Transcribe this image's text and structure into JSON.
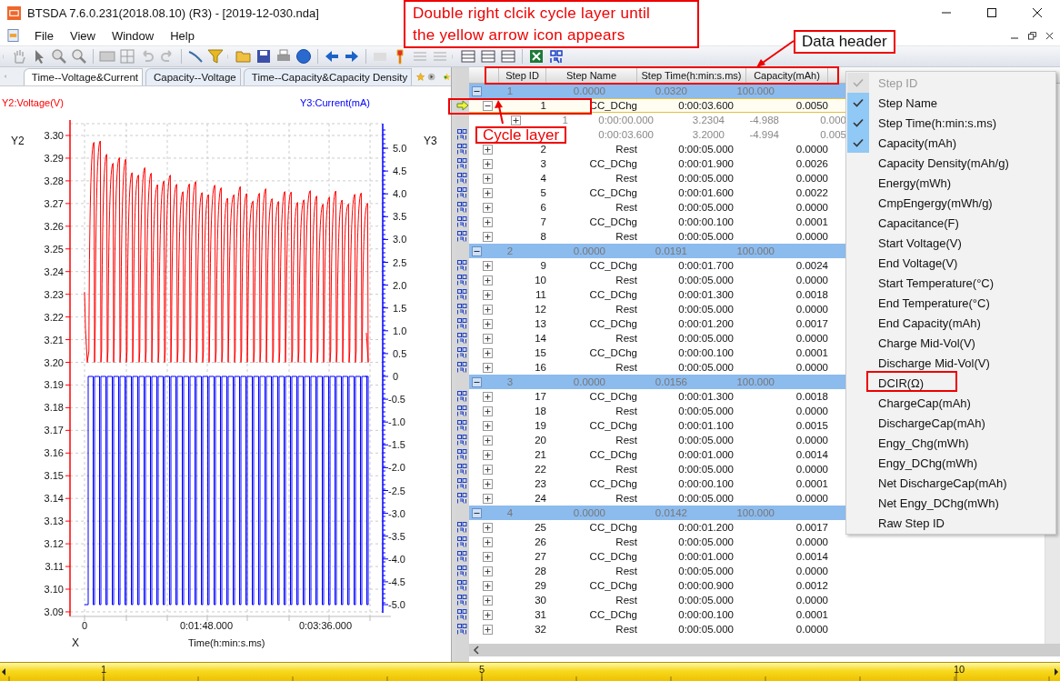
{
  "window": {
    "title": "BTSDA 7.6.0.231(2018.08.10) (R3) - [2019-12-030.nda]"
  },
  "menu": [
    "File",
    "View",
    "Window",
    "Help"
  ],
  "chart_tabs": [
    {
      "label": "Time--Voltage&Current",
      "selected": true
    },
    {
      "label": "Capacity--Voltage",
      "selected": false
    },
    {
      "label": "Time--Capacity&Capacity Density",
      "selected": false
    }
  ],
  "chart": {
    "y2_title": "Y2:Voltage(V)",
    "y3_title": "Y3:Current(mA)",
    "y2_name": "Y2",
    "y3_name": "Y3",
    "x_name": "X",
    "x_title": "Time(h:min:s.ms)",
    "y2_ticks": [
      "3.30",
      "3.29",
      "3.28",
      "3.27",
      "3.26",
      "3.25",
      "3.24",
      "3.23",
      "3.22",
      "3.21",
      "3.20",
      "3.19",
      "3.18",
      "3.17",
      "3.16",
      "3.15",
      "3.14",
      "3.13",
      "3.12",
      "3.11",
      "3.10",
      "3.09"
    ],
    "y3_ticks": [
      "5.0",
      "4.5",
      "4.0",
      "3.5",
      "3.0",
      "2.5",
      "2.0",
      "1.5",
      "1.0",
      "0.5",
      "0",
      "-0.5",
      "-1.0",
      "-1.5",
      "-2.0",
      "-2.5",
      "-3.0",
      "-3.5",
      "-4.0",
      "-4.5",
      "-5.0"
    ],
    "x_ticks": [
      "0",
      "0:01:48.000",
      "0:03:36.000"
    ]
  },
  "table": {
    "columns": [
      "Step ID",
      "Step Name",
      "Step Time(h:min:s.ms)",
      "Capacity(mAh)"
    ],
    "cycles": [
      {
        "cells": [
          "1",
          "0.0000",
          "0.0320",
          "100.000"
        ],
        "expanded": true,
        "steps": [
          {
            "cells": [
              "1",
              "CC_DChg",
              "0:00:03.600",
              "0.0050"
            ],
            "kind": "arrow",
            "expanded": true,
            "selected": true,
            "records": [
              {
                "id": "1",
                "cells": [
                  "0:00:00.000",
                  "3.2304",
                  "-4.988",
                  "0.000"
                ],
                "expanded": false
              },
              {
                "cells": [
                  "0:00:03.600",
                  "3.2000",
                  "-4.994",
                  "0.005"
                ],
                "kind": "dcir"
              }
            ]
          },
          {
            "cells": [
              "2",
              "Rest",
              "0:00:05.000",
              "0.0000"
            ],
            "kind": "dcir",
            "expanded": false,
            "selected": false
          },
          {
            "cells": [
              "3",
              "CC_DChg",
              "0:00:01.900",
              "0.0026"
            ],
            "kind": "dcir",
            "expanded": false,
            "selected": false
          },
          {
            "cells": [
              "4",
              "Rest",
              "0:00:05.000",
              "0.0000"
            ],
            "kind": "dcir",
            "expanded": false,
            "selected": false
          },
          {
            "cells": [
              "5",
              "CC_DChg",
              "0:00:01.600",
              "0.0022"
            ],
            "kind": "dcir",
            "expanded": false,
            "selected": false
          },
          {
            "cells": [
              "6",
              "Rest",
              "0:00:05.000",
              "0.0000"
            ],
            "kind": "dcir",
            "expanded": false,
            "selected": false
          },
          {
            "cells": [
              "7",
              "CC_DChg",
              "0:00:00.100",
              "0.0001"
            ],
            "kind": "dcir",
            "expanded": false,
            "selected": false
          },
          {
            "cells": [
              "8",
              "Rest",
              "0:00:05.000",
              "0.0000"
            ],
            "kind": "dcir",
            "expanded": false,
            "selected": false
          }
        ]
      },
      {
        "cells": [
          "2",
          "0.0000",
          "0.0191",
          "100.000"
        ],
        "expanded": true,
        "steps": [
          {
            "cells": [
              "9",
              "CC_DChg",
              "0:00:01.700",
              "0.0024"
            ],
            "kind": "dcir",
            "expanded": false,
            "selected": false
          },
          {
            "cells": [
              "10",
              "Rest",
              "0:00:05.000",
              "0.0000"
            ],
            "kind": "dcir",
            "expanded": false,
            "selected": false
          },
          {
            "cells": [
              "11",
              "CC_DChg",
              "0:00:01.300",
              "0.0018"
            ],
            "kind": "dcir",
            "expanded": false,
            "selected": false
          },
          {
            "cells": [
              "12",
              "Rest",
              "0:00:05.000",
              "0.0000"
            ],
            "kind": "dcir",
            "expanded": false,
            "selected": false
          },
          {
            "cells": [
              "13",
              "CC_DChg",
              "0:00:01.200",
              "0.0017"
            ],
            "kind": "dcir",
            "expanded": false,
            "selected": false
          },
          {
            "cells": [
              "14",
              "Rest",
              "0:00:05.000",
              "0.0000"
            ],
            "kind": "dcir",
            "expanded": false,
            "selected": false
          },
          {
            "cells": [
              "15",
              "CC_DChg",
              "0:00:00.100",
              "0.0001"
            ],
            "kind": "dcir",
            "expanded": false,
            "selected": false
          },
          {
            "cells": [
              "16",
              "Rest",
              "0:00:05.000",
              "0.0000"
            ],
            "kind": "dcir",
            "expanded": false,
            "selected": false
          }
        ]
      },
      {
        "cells": [
          "3",
          "0.0000",
          "0.0156",
          "100.000"
        ],
        "expanded": true,
        "steps": [
          {
            "cells": [
              "17",
              "CC_DChg",
              "0:00:01.300",
              "0.0018"
            ],
            "kind": "dcir",
            "expanded": false,
            "selected": false
          },
          {
            "cells": [
              "18",
              "Rest",
              "0:00:05.000",
              "0.0000"
            ],
            "kind": "dcir",
            "expanded": false,
            "selected": false
          },
          {
            "cells": [
              "19",
              "CC_DChg",
              "0:00:01.100",
              "0.0015"
            ],
            "kind": "dcir",
            "expanded": false,
            "selected": false
          },
          {
            "cells": [
              "20",
              "Rest",
              "0:00:05.000",
              "0.0000"
            ],
            "kind": "dcir",
            "expanded": false,
            "selected": false
          },
          {
            "cells": [
              "21",
              "CC_DChg",
              "0:00:01.000",
              "0.0014"
            ],
            "kind": "dcir",
            "expanded": false,
            "selected": false
          },
          {
            "cells": [
              "22",
              "Rest",
              "0:00:05.000",
              "0.0000"
            ],
            "kind": "dcir",
            "expanded": false,
            "selected": false
          },
          {
            "cells": [
              "23",
              "CC_DChg",
              "0:00:00.100",
              "0.0001"
            ],
            "kind": "dcir",
            "expanded": false,
            "selected": false
          },
          {
            "cells": [
              "24",
              "Rest",
              "0:00:05.000",
              "0.0000"
            ],
            "kind": "dcir",
            "expanded": false,
            "selected": false
          }
        ]
      },
      {
        "cells": [
          "4",
          "0.0000",
          "0.0142",
          "100.000"
        ],
        "expanded": true,
        "steps": [
          {
            "cells": [
              "25",
              "CC_DChg",
              "0:00:01.200",
              "0.0017"
            ],
            "kind": "dcir",
            "expanded": false,
            "selected": false
          },
          {
            "cells": [
              "26",
              "Rest",
              "0:00:05.000",
              "0.0000"
            ],
            "kind": "dcir",
            "expanded": false,
            "selected": false
          },
          {
            "cells": [
              "27",
              "CC_DChg",
              "0:00:01.000",
              "0.0014"
            ],
            "kind": "dcir",
            "expanded": false,
            "selected": false
          },
          {
            "cells": [
              "28",
              "Rest",
              "0:00:05.000",
              "0.0000"
            ],
            "kind": "dcir",
            "expanded": false,
            "selected": false
          },
          {
            "cells": [
              "29",
              "CC_DChg",
              "0:00:00.900",
              "0.0012"
            ],
            "kind": "dcir",
            "expanded": false,
            "selected": false
          },
          {
            "cells": [
              "30",
              "Rest",
              "0:00:05.000",
              "0.0000"
            ],
            "kind": "dcir",
            "expanded": false,
            "selected": false
          },
          {
            "cells": [
              "31",
              "CC_DChg",
              "0:00:00.100",
              "0.0001"
            ],
            "kind": "dcir",
            "expanded": false,
            "selected": false
          },
          {
            "cells": [
              "32",
              "Rest",
              "0:00:05.000",
              "0.0000"
            ],
            "kind": "dcir",
            "expanded": false,
            "selected": false
          }
        ]
      }
    ]
  },
  "column_menu": {
    "items": [
      {
        "label": "Step ID",
        "checked": true,
        "disabled": true
      },
      {
        "label": "Step Name",
        "checked": true,
        "disabled": false
      },
      {
        "label": "Step Time(h:min:s.ms)",
        "checked": true,
        "disabled": false
      },
      {
        "label": "Capacity(mAh)",
        "checked": true,
        "disabled": false
      },
      {
        "label": "Capacity Density(mAh/g)",
        "checked": false,
        "disabled": false
      },
      {
        "label": "Energy(mWh)",
        "checked": false,
        "disabled": false
      },
      {
        "label": "CmpEngergy(mWh/g)",
        "checked": false,
        "disabled": false
      },
      {
        "label": "Capacitance(F)",
        "checked": false,
        "disabled": false
      },
      {
        "label": "Start Voltage(V)",
        "checked": false,
        "disabled": false
      },
      {
        "label": "End Voltage(V)",
        "checked": false,
        "disabled": false
      },
      {
        "label": "Start Temperature(°C)",
        "checked": false,
        "disabled": false
      },
      {
        "label": "End Temperature(°C)",
        "checked": false,
        "disabled": false
      },
      {
        "label": "End Capacity(mAh)",
        "checked": false,
        "disabled": false
      },
      {
        "label": "Charge Mid-Vol(V)",
        "checked": false,
        "disabled": false
      },
      {
        "label": "Discharge Mid-Vol(V)",
        "checked": false,
        "disabled": false
      },
      {
        "label": "DCIR(Ω)",
        "checked": false,
        "disabled": false
      },
      {
        "label": "ChargeCap(mAh)",
        "checked": false,
        "disabled": false
      },
      {
        "label": "DischargeCap(mAh)",
        "checked": false,
        "disabled": false
      },
      {
        "label": "Engy_Chg(mWh)",
        "checked": false,
        "disabled": false
      },
      {
        "label": "Engy_DChg(mWh)",
        "checked": false,
        "disabled": false
      },
      {
        "label": "Net DischargeCap(mAh)",
        "checked": false,
        "disabled": false
      },
      {
        "label": "Net Engy_DChg(mWh)",
        "checked": false,
        "disabled": false
      },
      {
        "label": "Raw Step ID",
        "checked": false,
        "disabled": false
      }
    ]
  },
  "ruler": {
    "labels": [
      "1",
      "5",
      "10"
    ]
  },
  "annotations": {
    "instruction": [
      "Double right clcik cycle layer until",
      "the yellow arrow icon appears"
    ],
    "header_callout": "Data header",
    "cycle_callout": "Cycle layer"
  }
}
